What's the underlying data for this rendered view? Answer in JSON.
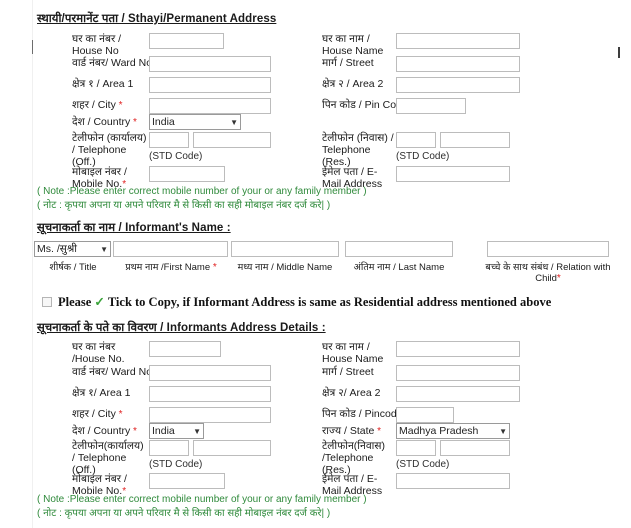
{
  "sections": {
    "permanent_address": {
      "title": "स्थायी/परमानेंट पता / Sthayi/Permanent Address",
      "fields": {
        "house_no_label": "घर का नंबर / House No",
        "house_name_label": "घर का नाम / House Name",
        "ward_no_label": "वार्ड नंबर/ Ward No.",
        "street_label": "मार्ग / Street",
        "area1_label": "क्षेत्र १ / Area 1",
        "area2_label": "क्षेत्र २ / Area 2",
        "city_label": "शहर / City",
        "pincode_label": "पिन कोड / Pin Code",
        "country_label": "देश / Country",
        "country_value": "India",
        "telephone_off_label": "टेलीफोन (कार्यालय) / Telephone (Off.)",
        "telephone_res_label": "टेलीफोन (निवास) / Telephone (Res.)",
        "std_code_note": "(STD Code)",
        "mobile_label": "मोबाइल नंबर / Mobile No.",
        "email_label": "ईमेल पता / E-Mail Address"
      },
      "note_en": "( Note :Please enter correct mobile number of your or any family member )",
      "note_hi": "( नोट : कृपया अपना या अपने परिवार मै से किसी का सही मोबाइल नंबर दर्ज करे| )"
    },
    "informant_name": {
      "title": "सूचनाकर्ता का नाम / Informant's Name :",
      "title_value": "Ms. /सुश्री",
      "columns": [
        {
          "label": "शीर्षक / Title",
          "required": false
        },
        {
          "label": "प्रथम नाम /First Name",
          "required": true
        },
        {
          "label": "मध्य नाम / Middle Name",
          "required": false
        },
        {
          "label": "अंतिम नाम / Last Name",
          "required": false
        },
        {
          "label": "बच्चे के साथ संबंध / Relation with Child",
          "required": true
        }
      ]
    },
    "copy_row": {
      "text_before": "Please",
      "tick": "✓",
      "text_after": "Tick to Copy, if Informant Address is same as Residential address mentioned above",
      "checked": false
    },
    "informant_address": {
      "title": "सूचनाकर्ता के पते का विवरण / Informants Address Details :",
      "fields": {
        "house_no_label": "घर का नंबर /House No.",
        "house_name_label": "घर का नाम / House Name",
        "ward_no_label": "वार्ड नंबर/ Ward No.",
        "street_label": "मार्ग / Street",
        "area1_label": "क्षेत्र १/ Area 1",
        "area2_label": "क्षेत्र २/ Area 2",
        "city_label": "शहर / City",
        "pincode_label": "पिन कोड / Pincode",
        "country_label": "देश / Country",
        "country_value": "India",
        "state_label": "राज्य / State",
        "state_value": "Madhya Pradesh",
        "telephone_off_label": "टेलीफोन(कार्यालय) / Telephone (Off.)",
        "telephone_res_label": "टेलीफोन(निवास) /Telephone (Res.)",
        "std_code_note": "(STD Code)",
        "mobile_label": "मोबाइल नंबर / Mobile No.",
        "email_label": "ईमेल पता / E-Mail Address"
      },
      "note_en": "( Note :Please enter correct mobile number of your or any family member )",
      "note_hi": "( नोट : कृपया अपना या अपने परिवार मै से किसी का सही मोबाइल नंबर दर्ज करे| )"
    }
  },
  "colors": {
    "required_asterisk": "#e02020",
    "note_green": "#2f8a3b",
    "field_border": "#bcbcbc"
  }
}
